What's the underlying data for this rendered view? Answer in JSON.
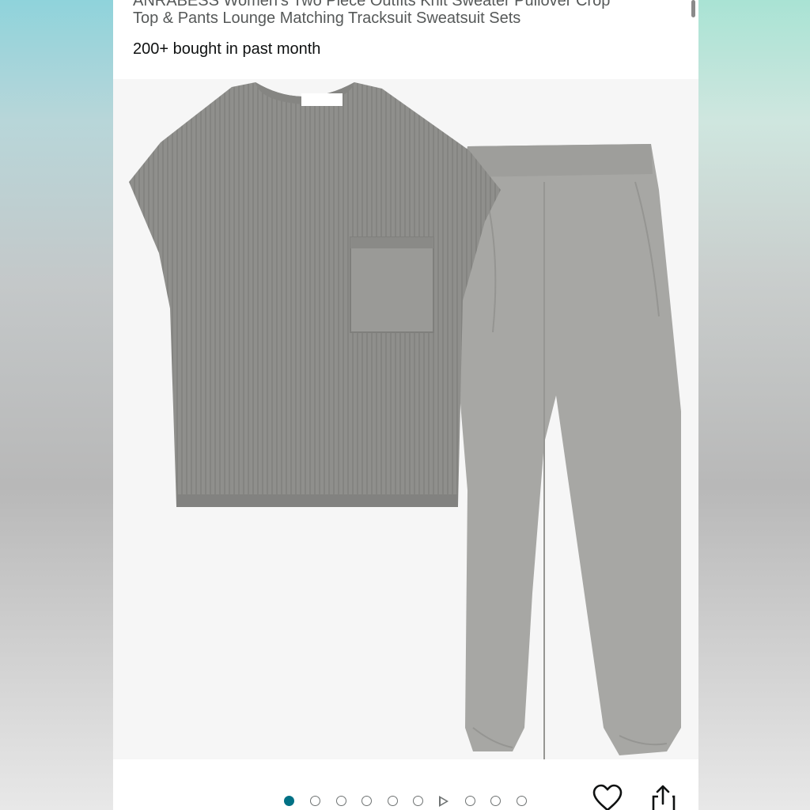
{
  "product": {
    "title_line1": "ANRABESS Women's Two Piece Outfits Knit Sweater Pullover Crop",
    "title_line2": "Top & Pants Lounge Matching Tracksuit Sweatsuit Sets",
    "bought": "200+ bought in past month",
    "brand_tag": "ANRABESS"
  },
  "carousel": {
    "total_dots": 10,
    "active_index": 0,
    "video_index": 6
  },
  "actions": {
    "wishlist_icon": "heart-icon",
    "share_icon": "share-icon"
  },
  "colors": {
    "active_dot": "#007185",
    "garment": "#8e8e8c"
  }
}
